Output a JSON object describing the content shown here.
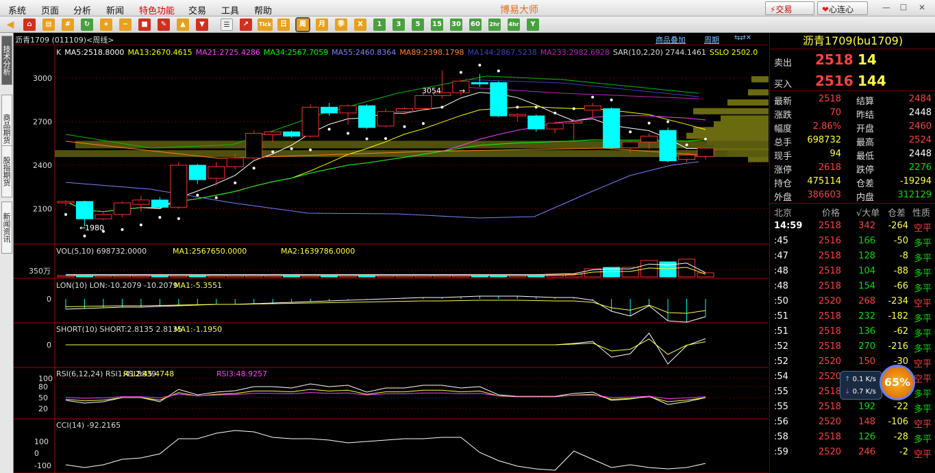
{
  "menu": {
    "items": [
      "系统",
      "页面",
      "分析",
      "新闻",
      "特色功能",
      "交易",
      "工具",
      "帮助"
    ],
    "app_title": "博易大师",
    "trade_btn": "交易",
    "xinlianxin_btn": "心连心"
  },
  "toolbar": {
    "period_buttons": [
      "日",
      "周",
      "月",
      "季",
      "X",
      "1",
      "3",
      "5",
      "15",
      "30",
      "60",
      "2hr",
      "4hr",
      "Y"
    ],
    "tick_label": "Tick"
  },
  "left_tabs": [
    "技术分析",
    "商品期货",
    "股指期货",
    "新闻资讯"
  ],
  "chart": {
    "title": "沥青1709 (011109)<周线>",
    "overlay_btn": "商品叠加",
    "period_btn": "周期",
    "ma_line": [
      {
        "text": "K",
        "color": "#dddddd"
      },
      {
        "text": "MA5:2518.8000",
        "color": "#ffffff"
      },
      {
        "text": "MA13:2670.4615",
        "color": "#ffff00"
      },
      {
        "text": "MA21:2725.4286",
        "color": "#ff40ff"
      },
      {
        "text": "MA34:2567.7059",
        "color": "#00ff00"
      },
      {
        "text": "MA55:2460.8364",
        "color": "#8080ff"
      },
      {
        "text": "MA89:2398.1798",
        "color": "#ff8020"
      },
      {
        "text": "MA144:2867.5238",
        "color": "#4040c0"
      },
      {
        "text": "MA233:2982.6928",
        "color": "#c020c0"
      },
      {
        "text": "SAR(10,2,20) 2744.1461",
        "color": "#dddddd"
      },
      {
        "text": "SSLO 2502.0",
        "color": "#ffff00"
      }
    ],
    "price_ticks": [
      "3000",
      "2700",
      "2400",
      "2100"
    ],
    "high_label": "3054",
    "low_label": "1980",
    "vol_title": "VOL(5,10) 698732.0000",
    "vol_ma1": "MA1:2567650.0000",
    "vol_ma2": "MA2:1639786.0000",
    "vol_tick": "350万",
    "lon_title": "LON(10) LON:-10.2079 -10.2079",
    "lon_ma": "MA1:-5.3551",
    "lon_tick": "0",
    "short_title": "SHORT(10) SHORT:2.8135 2.8135",
    "short_ma": "MA1:-1.1950",
    "short_tick": "0",
    "rsi_title": "RSI(6,12,24) RSI1:41.8839",
    "rsi2": "RSI2:45.4748",
    "rsi3": "RSI3:48.9257",
    "rsi_ticks": [
      "100",
      "80",
      "50",
      "20"
    ],
    "cci_title": "CCI(14) -92.2165",
    "cci_ticks": [
      "100",
      "0",
      "-100"
    ]
  },
  "chart_data": {
    "type": "candlestick",
    "title": "沥青1709 (011109)<周线>",
    "candles": [
      {
        "o": 2140,
        "h": 2160,
        "l": 2120,
        "c": 2150
      },
      {
        "o": 2150,
        "h": 2155,
        "l": 1980,
        "c": 2030
      },
      {
        "o": 2030,
        "h": 2070,
        "l": 2020,
        "c": 2060
      },
      {
        "o": 2060,
        "h": 2150,
        "l": 2040,
        "c": 2140
      },
      {
        "o": 2130,
        "h": 2190,
        "l": 2080,
        "c": 2160
      },
      {
        "o": 2160,
        "h": 2180,
        "l": 2100,
        "c": 2110
      },
      {
        "o": 2110,
        "h": 2420,
        "l": 2100,
        "c": 2400
      },
      {
        "o": 2400,
        "h": 2410,
        "l": 2270,
        "c": 2300
      },
      {
        "o": 2310,
        "h": 2420,
        "l": 2260,
        "c": 2390
      },
      {
        "o": 2390,
        "h": 2480,
        "l": 2370,
        "c": 2450
      },
      {
        "o": 2450,
        "h": 2640,
        "l": 2440,
        "c": 2620
      },
      {
        "o": 2610,
        "h": 2640,
        "l": 2560,
        "c": 2630
      },
      {
        "o": 2630,
        "h": 2640,
        "l": 2590,
        "c": 2600
      },
      {
        "o": 2600,
        "h": 2820,
        "l": 2590,
        "c": 2800
      },
      {
        "o": 2800,
        "h": 2830,
        "l": 2740,
        "c": 2760
      },
      {
        "o": 2760,
        "h": 2820,
        "l": 2680,
        "c": 2810
      },
      {
        "o": 2810,
        "h": 2820,
        "l": 2650,
        "c": 2660
      },
      {
        "o": 2670,
        "h": 2790,
        "l": 2660,
        "c": 2770
      },
      {
        "o": 2770,
        "h": 2800,
        "l": 2750,
        "c": 2790
      },
      {
        "o": 2790,
        "h": 2900,
        "l": 2780,
        "c": 2880
      },
      {
        "o": 2880,
        "h": 3054,
        "l": 2860,
        "c": 2900
      },
      {
        "o": 2900,
        "h": 2990,
        "l": 2880,
        "c": 2980
      },
      {
        "o": 2970,
        "h": 3030,
        "l": 2940,
        "c": 2960
      },
      {
        "o": 2970,
        "h": 2980,
        "l": 2730,
        "c": 2740
      },
      {
        "o": 2740,
        "h": 2760,
        "l": 2700,
        "c": 2750
      },
      {
        "o": 2740,
        "h": 2750,
        "l": 2630,
        "c": 2650
      },
      {
        "o": 2650,
        "h": 2700,
        "l": 2620,
        "c": 2690
      },
      {
        "o": 2690,
        "h": 2720,
        "l": 2560,
        "c": 2700
      },
      {
        "o": 2780,
        "h": 2830,
        "l": 2730,
        "c": 2810
      },
      {
        "o": 2790,
        "h": 2800,
        "l": 2510,
        "c": 2520
      },
      {
        "o": 2520,
        "h": 2570,
        "l": 2480,
        "c": 2560
      },
      {
        "o": 2560,
        "h": 2620,
        "l": 2510,
        "c": 2600
      },
      {
        "o": 2640,
        "h": 2660,
        "l": 2420,
        "c": 2430
      },
      {
        "o": 2440,
        "h": 2490,
        "l": 2420,
        "c": 2470
      },
      {
        "o": 2460,
        "h": 2520,
        "l": 2440,
        "c": 2518
      }
    ],
    "ylim": [
      1880,
      3180
    ]
  },
  "quote": {
    "contract": "沥青1709(bu1709)",
    "sell_label": "卖出",
    "sell_price": "2518",
    "sell_vol": "14",
    "buy_label": "买入",
    "buy_price": "2516",
    "buy_vol": "144",
    "rows": [
      {
        "l1": "最新",
        "v1": "2518",
        "c1": "red",
        "l2": "结算",
        "v2": "2484",
        "c2": "red"
      },
      {
        "l1": "涨跌",
        "v1": "70",
        "c1": "red",
        "l2": "昨结",
        "v2": "2448",
        "c2": "wht"
      },
      {
        "l1": "幅度",
        "v1": "2.86%",
        "c1": "red",
        "l2": "开盘",
        "v2": "2460",
        "c2": "red"
      },
      {
        "l1": "总手",
        "v1": "698732",
        "c1": "yel",
        "l2": "最高",
        "v2": "2524",
        "c2": "red"
      },
      {
        "l1": "现手",
        "v1": "94",
        "c1": "yel",
        "l2": "最低",
        "v2": "2448",
        "c2": "wht"
      },
      {
        "l1": "涨停",
        "v1": "2618",
        "c1": "red",
        "l2": "跌停",
        "v2": "2276",
        "c2": "grn"
      },
      {
        "l1": "持仓",
        "v1": "475114",
        "c1": "yel",
        "l2": "仓差",
        "v2": "-19294",
        "c2": "yel"
      },
      {
        "l1": "外盘",
        "v1": "386603",
        "c1": "red",
        "l2": "内盘",
        "v2": "312129",
        "c2": "grn"
      }
    ],
    "tick_header": {
      "h1": "北京",
      "h2": "价格",
      "h3": "√大单",
      "h4": "仓差",
      "h5": "性质"
    },
    "ticks": [
      {
        "t": "14:59",
        "p": "2518",
        "v": "342",
        "d": "-264",
        "n": "空平",
        "nc": "red"
      },
      {
        "t": ":45",
        "p": "2516",
        "v": "166",
        "d": "-50",
        "n": "多平",
        "nc": "grn"
      },
      {
        "t": ":47",
        "p": "2518",
        "v": "128",
        "d": "-8",
        "n": "多平",
        "nc": "grn"
      },
      {
        "t": ":48",
        "p": "2518",
        "v": "104",
        "d": "-88",
        "n": "多平",
        "nc": "grn"
      },
      {
        "t": ":48",
        "p": "2518",
        "v": "154",
        "d": "-66",
        "n": "多平",
        "nc": "grn"
      },
      {
        "t": ":50",
        "p": "2520",
        "v": "268",
        "d": "-234",
        "n": "空平",
        "nc": "red"
      },
      {
        "t": ":51",
        "p": "2518",
        "v": "232",
        "d": "-182",
        "n": "多平",
        "nc": "grn"
      },
      {
        "t": ":51",
        "p": "2518",
        "v": "136",
        "d": "-62",
        "n": "多平",
        "nc": "grn"
      },
      {
        "t": ":52",
        "p": "2518",
        "v": "270",
        "d": "-216",
        "n": "多平",
        "nc": "grn"
      },
      {
        "t": ":52",
        "p": "2520",
        "v": "150",
        "d": "-30",
        "n": "空平",
        "nc": "red"
      },
      {
        "t": ":54",
        "p": "2520",
        "v": "102",
        "d": "-36",
        "n": "空平",
        "nc": "red"
      },
      {
        "t": ":55",
        "p": "2518",
        "v": "220",
        "d": "-48",
        "n": "多平",
        "nc": "grn"
      },
      {
        "t": ":55",
        "p": "2518",
        "v": "192",
        "d": "-22",
        "n": "多平",
        "nc": "grn"
      },
      {
        "t": ":56",
        "p": "2520",
        "v": "148",
        "d": "-106",
        "n": "空平",
        "nc": "red"
      },
      {
        "t": ":58",
        "p": "2518",
        "v": "126",
        "d": "-28",
        "n": "多平",
        "nc": "grn"
      },
      {
        "t": ":59",
        "p": "2520",
        "v": "246",
        "d": "-2",
        "n": "空平",
        "nc": "red"
      }
    ]
  },
  "speed_widget": {
    "up": "0.1 K/s",
    "down": "0.7 K/s",
    "badge": "65%"
  }
}
